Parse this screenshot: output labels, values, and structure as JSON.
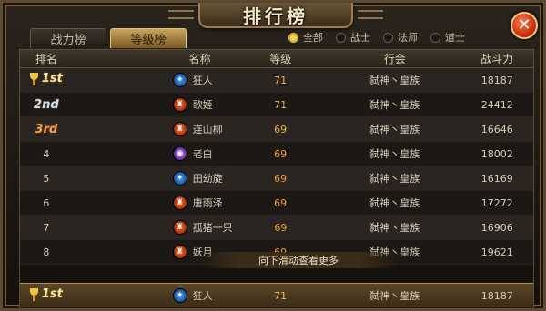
{
  "title": "排行榜",
  "close_label": "✕",
  "tabs": [
    {
      "label": "战力榜",
      "active": false
    },
    {
      "label": "等级榜",
      "active": true
    }
  ],
  "filters": [
    {
      "label": "全部",
      "selected": true
    },
    {
      "label": "战士",
      "selected": false
    },
    {
      "label": "法师",
      "selected": false
    },
    {
      "label": "道士",
      "selected": false
    }
  ],
  "columns": {
    "rank": "排名",
    "name": "名称",
    "level": "等级",
    "guild": "行会",
    "power": "战斗力"
  },
  "rows": [
    {
      "rank": "1st",
      "medal": "gold",
      "class": "mage",
      "name": "狂人",
      "level": "71",
      "guild": "弑神丶皇族",
      "power": "18187"
    },
    {
      "rank": "2nd",
      "medal": "silver",
      "class": "warrior",
      "name": "歌姬",
      "level": "71",
      "guild": "弑神丶皇族",
      "power": "24412"
    },
    {
      "rank": "3rd",
      "medal": "bronze",
      "class": "warrior",
      "name": "连山柳",
      "level": "69",
      "guild": "弑神丶皇族",
      "power": "16646"
    },
    {
      "rank": "4",
      "medal": "",
      "class": "taoist",
      "name": "老白",
      "level": "69",
      "guild": "弑神丶皇族",
      "power": "18002"
    },
    {
      "rank": "5",
      "medal": "",
      "class": "mage",
      "name": "田幼旋",
      "level": "69",
      "guild": "弑神丶皇族",
      "power": "16169"
    },
    {
      "rank": "6",
      "medal": "",
      "class": "warrior",
      "name": "唐雨泽",
      "level": "69",
      "guild": "弑神丶皇族",
      "power": "17272"
    },
    {
      "rank": "7",
      "medal": "",
      "class": "warrior",
      "name": "孤猪一只",
      "level": "69",
      "guild": "弑神丶皇族",
      "power": "16906"
    },
    {
      "rank": "8",
      "medal": "",
      "class": "warrior",
      "name": "妖月",
      "level": "69",
      "guild": "弑神丶皇族",
      "power": "19621"
    }
  ],
  "scroll_hint": "向下滑动查看更多",
  "my_row": {
    "rank": "1st",
    "medal": "gold",
    "class": "mage",
    "name": "狂人",
    "level": "71",
    "guild": "弑神丶皇族",
    "power": "18187"
  },
  "icons": {
    "warrior": "warrior-class-icon",
    "mage": "mage-class-icon",
    "taoist": "taoist-class-icon",
    "trophy": "trophy-icon",
    "close": "close-icon"
  },
  "colors": {
    "accent_gold": "#e0b83a",
    "level_orange": "#f29a2e",
    "close_red": "#c0280a"
  }
}
